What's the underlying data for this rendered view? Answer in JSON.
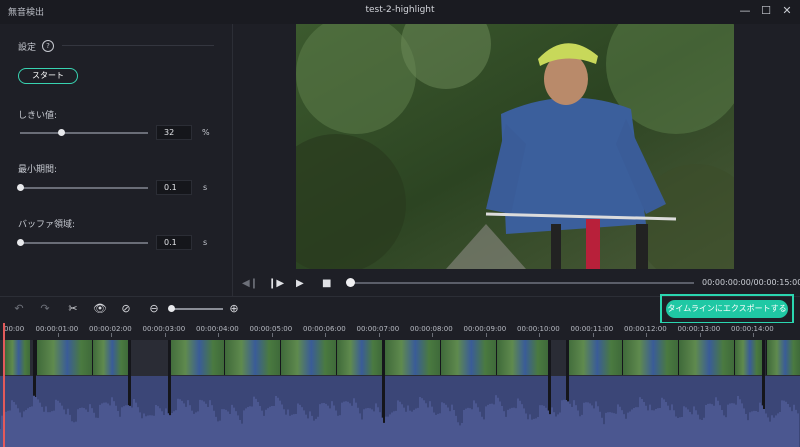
{
  "window": {
    "app_title": "無音検出",
    "document_title": "test-2-highlight",
    "minimize_glyph": "—",
    "maximize_glyph": "☐",
    "close_glyph": "✕"
  },
  "settings": {
    "section_label": "設定",
    "help_glyph": "?",
    "start_label": "スタート",
    "threshold": {
      "label": "しきい値:",
      "value": "32",
      "unit": "%",
      "level": 0.32
    },
    "min_duration": {
      "label": "最小期間:",
      "value": "0.1",
      "unit": "s",
      "level": 0.0
    },
    "buffer": {
      "label": "バッファ領域:",
      "value": "0.1",
      "unit": "s",
      "level": 0.0
    }
  },
  "player": {
    "timecode": "00:00:00:00/00:00:15:00",
    "progress": 0.0,
    "icons": [
      "prev-frame-icon",
      "play-pause-icon",
      "play-icon",
      "stop-icon"
    ]
  },
  "toolbar": {
    "export_label": "タイムラインにエクスポートする",
    "icons": [
      "undo-icon",
      "redo-icon",
      "cut-icon",
      "eye-icon",
      "eye-off-icon",
      "zoom-out-icon",
      "zoom-in-icon"
    ],
    "zoom_level": 0.0
  },
  "ruler": {
    "ticks": [
      "00:00",
      "00:00:01:00",
      "00:00:02:00",
      "00:00:03:00",
      "00:00:04:00",
      "00:00:05:00",
      "00:00:06:00",
      "00:00:07:00",
      "00:00:08:00",
      "00:00:09:00",
      "00:00:10:00",
      "00:00:11:00",
      "00:00:12:00",
      "00:00:13:00",
      "00:00:14:00"
    ]
  },
  "colors": {
    "accent": "#1fc8a4",
    "accent_border": "#2bd6b0",
    "playhead": "#e35a5a",
    "audio_wave": "#4b5790",
    "audio_bg": "#3b4677"
  }
}
